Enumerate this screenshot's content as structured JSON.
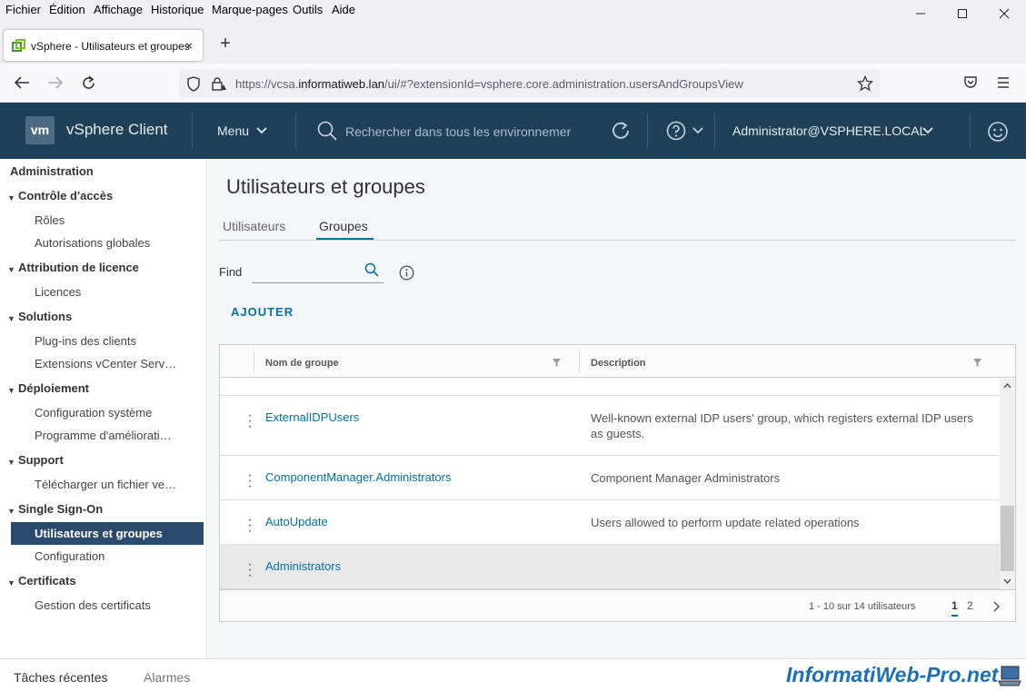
{
  "menubar": {
    "items": [
      "Fichier",
      "Édition",
      "Affichage",
      "Historique",
      "Marque-pages",
      "Outils",
      "Aide"
    ]
  },
  "browser": {
    "tab_title": "vSphere - Utilisateurs et groupes",
    "tab_close": "×",
    "new_tab": "+",
    "url_prefix": "https://vcsa.",
    "url_domain": "informatiweb.lan",
    "url_path": "/ui/#?extensionId=vsphere.core.administration.usersAndGroupsView"
  },
  "header": {
    "logo": "vm",
    "app_name": "vSphere Client",
    "menu_label": "Menu",
    "search_placeholder": "Rechercher dans tous les environnemer",
    "user": "Administrator@VSPHERE.LOCAL"
  },
  "sidebar": {
    "title": "Administration",
    "sections": [
      {
        "label": "Contrôle d'accès",
        "items": [
          "Rôles",
          "Autorisations globales"
        ]
      },
      {
        "label": "Attribution de licence",
        "items": [
          "Licences"
        ]
      },
      {
        "label": "Solutions",
        "items": [
          "Plug-ins des clients",
          "Extensions vCenter Serv…"
        ]
      },
      {
        "label": "Déploiement",
        "items": [
          "Configuration système",
          "Programme d'améliorati…"
        ]
      },
      {
        "label": "Support",
        "items": [
          "Télécharger un fichier ve…"
        ]
      },
      {
        "label": "Single Sign-On",
        "items": [
          "Utilisateurs et groupes",
          "Configuration"
        ]
      },
      {
        "label": "Certificats",
        "items": [
          "Gestion des certificats"
        ]
      }
    ],
    "active_item": "Utilisateurs et groupes"
  },
  "main": {
    "title": "Utilisateurs et groupes",
    "tabs": [
      "Utilisateurs",
      "Groupes"
    ],
    "active_tab": "Groupes",
    "find_label": "Find",
    "find_value": "",
    "add_button": "AJOUTER",
    "grid": {
      "columns": [
        "Nom de groupe",
        "Description"
      ],
      "rows": [
        {
          "name": "ExternalIDPUsers",
          "description": "Well-known external IDP users' group, which registers external IDP users as guests."
        },
        {
          "name": "ComponentManager.Administrators",
          "description": "Component Manager Administrators"
        },
        {
          "name": "AutoUpdate",
          "description": "Users allowed to perform update related operations"
        },
        {
          "name": "Administrators",
          "description": ""
        }
      ],
      "pagination_text": "1 - 10 sur 14 utilisateurs",
      "pages": [
        "1",
        "2"
      ],
      "current_page": "1"
    }
  },
  "bottom": {
    "tabs": [
      "Tâches récentes",
      "Alarmes"
    ]
  },
  "watermark": "InformatiWeb-Pro.net",
  "colors": {
    "header_bg": "#1f4057",
    "accent": "#0072a3",
    "sidebar_active": "#2a4a6b"
  }
}
